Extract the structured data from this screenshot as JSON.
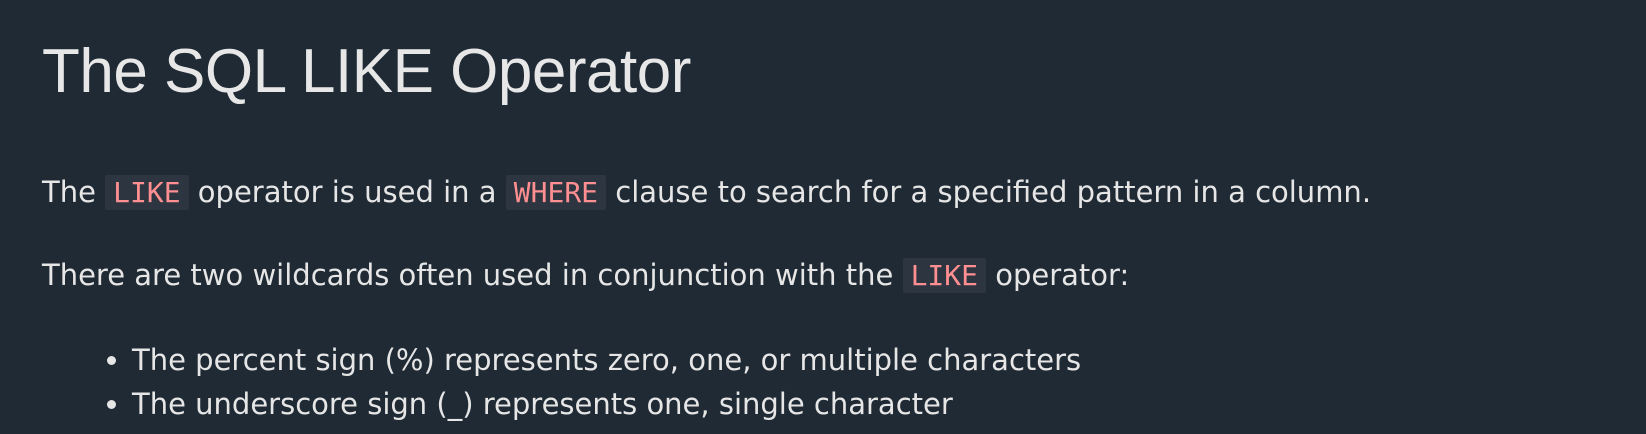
{
  "page": {
    "title": "The SQL LIKE Operator",
    "para1": {
      "t1": "The ",
      "code1": "LIKE",
      "t2": " operator is used in a ",
      "code2": "WHERE",
      "t3": " clause to search for a specified pattern in a column."
    },
    "para2": {
      "t1": "There are two wildcards often used in conjunction with the ",
      "code1": "LIKE",
      "t2": " operator:"
    },
    "bullets": [
      "The percent sign (%) represents zero, one, or multiple characters",
      "The underscore sign (_) represents one, single character"
    ]
  },
  "colors": {
    "background": "#1f2a35",
    "text": "#e6e6e6",
    "code_text": "#ff8f91",
    "code_bg": "#2c3540"
  }
}
